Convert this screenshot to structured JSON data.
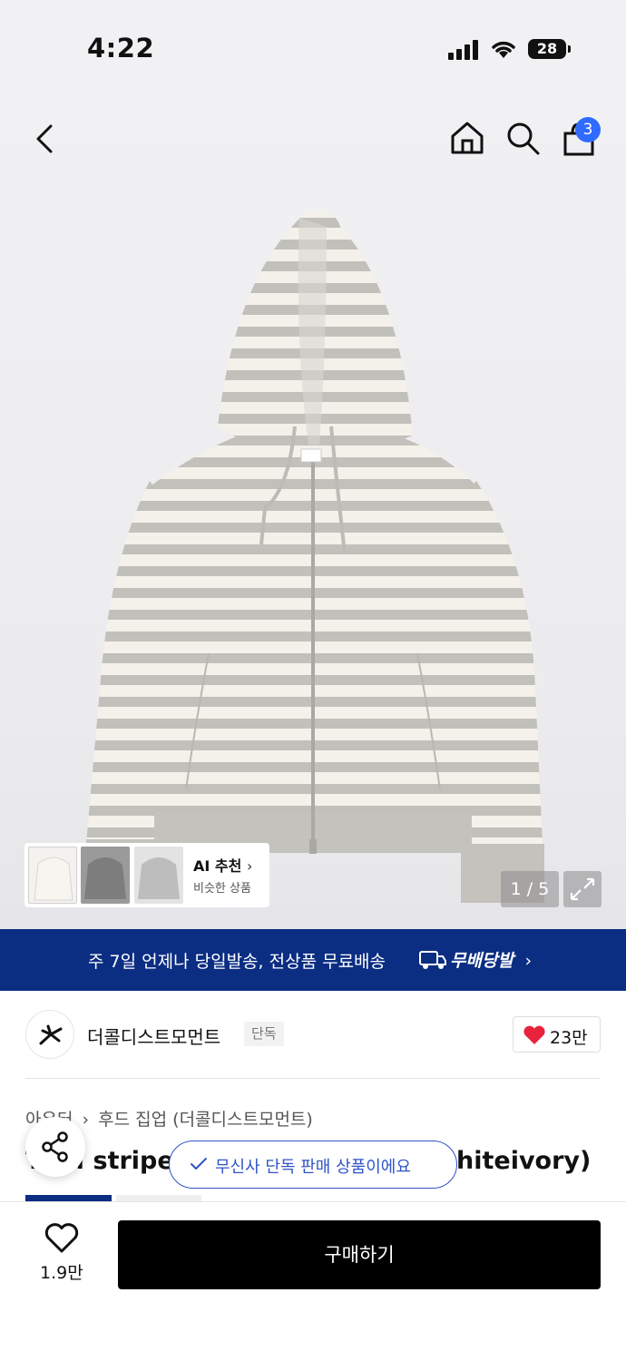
{
  "status_bar": {
    "time": "4:22",
    "battery": "28"
  },
  "header": {
    "icons": [
      "back-icon",
      "home-icon",
      "search-icon",
      "cart-icon"
    ],
    "cart_count": "3"
  },
  "gallery": {
    "ai_recommend_title": "AI 추천",
    "ai_recommend_subtitle": "비슷한 상품",
    "page_indicator": "1 / 5",
    "current_page": 1,
    "total_pages": 5
  },
  "promo": {
    "text": "주 7일 언제나 당일발송, 전상품 무료배송",
    "brand": "무배당발"
  },
  "brand": {
    "name": "더콜디스트모먼트",
    "tag": "단독",
    "likes": "23만"
  },
  "product": {
    "breadcrumb": [
      "아우터",
      "후드 집업 (더콜디스트모먼트)"
    ],
    "title_left": "TCM stripe",
    "title_right": "hiteivory)",
    "exclusive_notice": "무신사 단독 판매 상품이에요"
  },
  "bottom_bar": {
    "wish_count": "1.9만",
    "buy_label": "구매하기"
  },
  "colors": {
    "accent_blue": "#2f54c7",
    "promo_navy": "#0b2d82",
    "badge_blue": "#2f6bff",
    "heart_red": "#e8243c"
  }
}
